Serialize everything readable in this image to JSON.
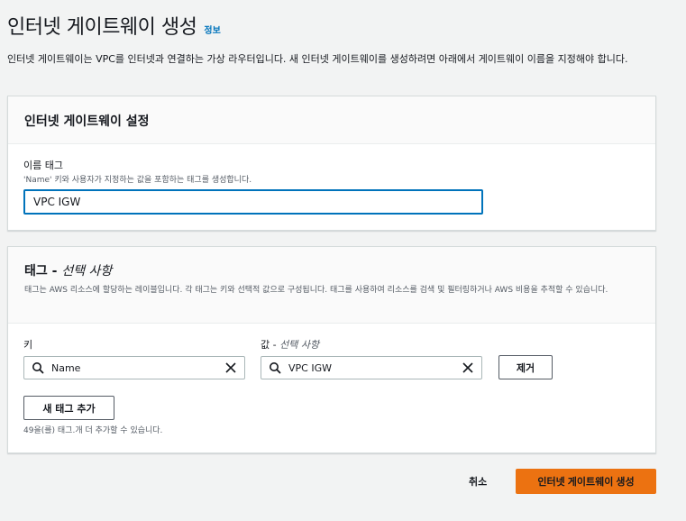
{
  "page": {
    "title": "인터넷 게이트웨이 생성",
    "info_link": "정보",
    "description": "인터넷 게이트웨이는 VPC를 인터넷과 연결하는 가상 라우터입니다. 새 인터넷 게이트웨이를 생성하려면 아래에서 게이트웨이 이름을 지정해야 합니다."
  },
  "settings_panel": {
    "title": "인터넷 게이트웨이 설정",
    "name_tag_label": "이름 태그",
    "name_tag_hint": "'Name' 키와 사용자가 지정하는 값을 포함하는 태그를 생성합니다.",
    "name_tag_value": "VPC IGW"
  },
  "tags_panel": {
    "title": "태그 - ",
    "title_optional": "선택 사항",
    "description": "태그는 AWS 리소스에 할당하는 레이블입니다. 각 태그는 키와 선택적 값으로 구성됩니다. 태그를 사용하여 리소스를 검색 및 필터링하거나 AWS 비용을 추적할 수 있습니다.",
    "key_label": "키",
    "value_label": "값 - ",
    "value_label_optional": "선택 사항",
    "tags": [
      {
        "key": "Name",
        "value": "VPC IGW"
      }
    ],
    "remove_button": "제거",
    "add_tag_button": "새 태그 추가",
    "remaining_text": "49을(를) 태그.개 더 추가할 수 있습니다."
  },
  "footer": {
    "cancel_label": "취소",
    "create_button": "인터넷 게이트웨이 생성"
  },
  "colors": {
    "primary": "#ec7211",
    "link": "#0073bb",
    "focus_border": "#0073bb"
  }
}
